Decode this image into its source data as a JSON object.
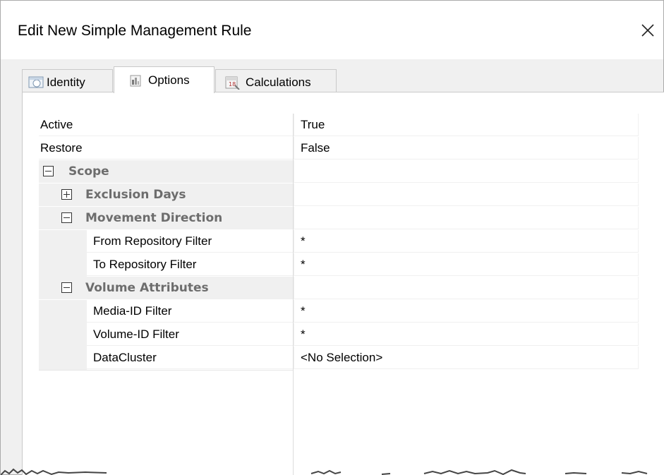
{
  "window": {
    "title": "Edit New Simple Management Rule"
  },
  "tabs": [
    {
      "label": "Identity",
      "icon": "identity-icon"
    },
    {
      "label": "Options",
      "icon": "options-icon"
    },
    {
      "label": "Calculations",
      "icon": "calculations-icon"
    }
  ],
  "properties": {
    "active": {
      "name": "Active",
      "value": "True"
    },
    "restore": {
      "name": "Restore",
      "value": "False"
    },
    "scope": {
      "name": "Scope",
      "expanded": true
    },
    "exclusion_days": {
      "name": "Exclusion Days",
      "expanded": false
    },
    "movement_direction": {
      "name": "Movement Direction",
      "expanded": true
    },
    "from_repository_filter": {
      "name": "From Repository Filter",
      "value": "*"
    },
    "to_repository_filter": {
      "name": "To Repository Filter",
      "value": "*"
    },
    "volume_attributes": {
      "name": "Volume Attributes",
      "expanded": true
    },
    "media_id_filter": {
      "name": "Media-ID Filter",
      "value": "*"
    },
    "volume_id_filter": {
      "name": "Volume-ID Filter",
      "value": "*"
    },
    "datacluster": {
      "name": "DataCluster",
      "value": "<No Selection>"
    }
  },
  "colors": {
    "category_text": "#6d6d6d",
    "category_background": "#f0f0f0"
  }
}
